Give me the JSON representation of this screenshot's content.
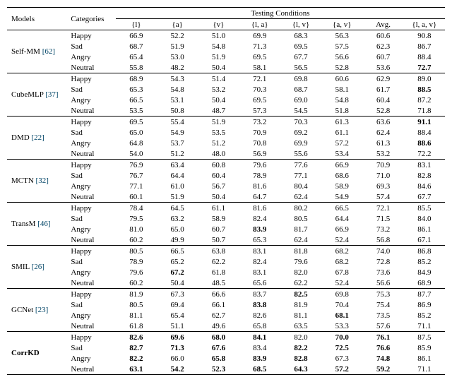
{
  "header": {
    "models": "Models",
    "categories": "Categories",
    "testing": "Testing Conditions",
    "cols": [
      "{l}",
      "{a}",
      "{v}",
      "{l, a}",
      "{l, v}",
      "{a, v}",
      "Avg.",
      "{l, a, v}"
    ]
  },
  "rows": [
    {
      "model": "Self-MM",
      "ref": "[62]",
      "cats": [
        {
          "name": "Happy",
          "vals": [
            "66.9",
            "52.2",
            "51.0",
            "69.9",
            "68.3",
            "56.3",
            "60.6",
            "90.8"
          ],
          "bold": []
        },
        {
          "name": "Sad",
          "vals": [
            "68.7",
            "51.9",
            "54.8",
            "71.3",
            "69.5",
            "57.5",
            "62.3",
            "86.7"
          ],
          "bold": []
        },
        {
          "name": "Angry",
          "vals": [
            "65.4",
            "53.0",
            "51.9",
            "69.5",
            "67.7",
            "56.6",
            "60.7",
            "88.4"
          ],
          "bold": []
        },
        {
          "name": "Neutral",
          "vals": [
            "55.8",
            "48.2",
            "50.4",
            "58.1",
            "56.5",
            "52.8",
            "53.6",
            "72.7"
          ],
          "bold": [
            7
          ]
        }
      ]
    },
    {
      "model": "CubeMLP",
      "ref": "[37]",
      "cats": [
        {
          "name": "Happy",
          "vals": [
            "68.9",
            "54.3",
            "51.4",
            "72.1",
            "69.8",
            "60.6",
            "62.9",
            "89.0"
          ],
          "bold": []
        },
        {
          "name": "Sad",
          "vals": [
            "65.3",
            "54.8",
            "53.2",
            "70.3",
            "68.7",
            "58.1",
            "61.7",
            "88.5"
          ],
          "bold": [
            7
          ]
        },
        {
          "name": "Angry",
          "vals": [
            "66.5",
            "53.1",
            "50.4",
            "69.5",
            "69.0",
            "54.8",
            "60.4",
            "87.2"
          ],
          "bold": []
        },
        {
          "name": "Neutral",
          "vals": [
            "53.5",
            "50.8",
            "48.7",
            "57.3",
            "54.5",
            "51.8",
            "52.8",
            "71.8"
          ],
          "bold": []
        }
      ]
    },
    {
      "model": "DMD",
      "ref": "[22]",
      "cats": [
        {
          "name": "Happy",
          "vals": [
            "69.5",
            "55.4",
            "51.9",
            "73.2",
            "70.3",
            "61.3",
            "63.6",
            "91.1"
          ],
          "bold": [
            7
          ]
        },
        {
          "name": "Sad",
          "vals": [
            "65.0",
            "54.9",
            "53.5",
            "70.9",
            "69.2",
            "61.1",
            "62.4",
            "88.4"
          ],
          "bold": []
        },
        {
          "name": "Angry",
          "vals": [
            "64.8",
            "53.7",
            "51.2",
            "70.8",
            "69.9",
            "57.2",
            "61.3",
            "88.6"
          ],
          "bold": [
            7
          ]
        },
        {
          "name": "Neutral",
          "vals": [
            "54.0",
            "51.2",
            "48.0",
            "56.9",
            "55.6",
            "53.4",
            "53.2",
            "72.2"
          ],
          "bold": []
        }
      ]
    },
    {
      "model": "MCTN",
      "ref": "[32]",
      "cats": [
        {
          "name": "Happy",
          "vals": [
            "76.9",
            "63.4",
            "60.8",
            "79.6",
            "77.6",
            "66.9",
            "70.9",
            "83.1"
          ],
          "bold": []
        },
        {
          "name": "Sad",
          "vals": [
            "76.7",
            "64.4",
            "60.4",
            "78.9",
            "77.1",
            "68.6",
            "71.0",
            "82.8"
          ],
          "bold": []
        },
        {
          "name": "Angry",
          "vals": [
            "77.1",
            "61.0",
            "56.7",
            "81.6",
            "80.4",
            "58.9",
            "69.3",
            "84.6"
          ],
          "bold": []
        },
        {
          "name": "Neutral",
          "vals": [
            "60.1",
            "51.9",
            "50.4",
            "64.7",
            "62.4",
            "54.9",
            "57.4",
            "67.7"
          ],
          "bold": []
        }
      ]
    },
    {
      "model": "TransM",
      "ref": "[46]",
      "cats": [
        {
          "name": "Happy",
          "vals": [
            "78.4",
            "64.5",
            "61.1",
            "81.6",
            "80.2",
            "66.5",
            "72.1",
            "85.5"
          ],
          "bold": []
        },
        {
          "name": "Sad",
          "vals": [
            "79.5",
            "63.2",
            "58.9",
            "82.4",
            "80.5",
            "64.4",
            "71.5",
            "84.0"
          ],
          "bold": []
        },
        {
          "name": "Angry",
          "vals": [
            "81.0",
            "65.0",
            "60.7",
            "83.9",
            "81.7",
            "66.9",
            "73.2",
            "86.1"
          ],
          "bold": [
            3
          ]
        },
        {
          "name": "Neutral",
          "vals": [
            "60.2",
            "49.9",
            "50.7",
            "65.3",
            "62.4",
            "52.4",
            "56.8",
            "67.1"
          ],
          "bold": []
        }
      ]
    },
    {
      "model": "SMIL",
      "ref": "[26]",
      "cats": [
        {
          "name": "Happy",
          "vals": [
            "80.5",
            "66.5",
            "63.8",
            "83.1",
            "81.8",
            "68.2",
            "74.0",
            "86.8"
          ],
          "bold": []
        },
        {
          "name": "Sad",
          "vals": [
            "78.9",
            "65.2",
            "62.2",
            "82.4",
            "79.6",
            "68.2",
            "72.8",
            "85.2"
          ],
          "bold": []
        },
        {
          "name": "Angry",
          "vals": [
            "79.6",
            "67.2",
            "61.8",
            "83.1",
            "82.0",
            "67.8",
            "73.6",
            "84.9"
          ],
          "bold": [
            1
          ]
        },
        {
          "name": "Neutral",
          "vals": [
            "60.2",
            "50.4",
            "48.5",
            "65.6",
            "62.2",
            "52.4",
            "56.6",
            "68.9"
          ],
          "bold": []
        }
      ]
    },
    {
      "model": "GCNet",
      "ref": "[23]",
      "cats": [
        {
          "name": "Happy",
          "vals": [
            "81.9",
            "67.3",
            "66.6",
            "83.7",
            "82.5",
            "69.8",
            "75.3",
            "87.7"
          ],
          "bold": [
            4
          ]
        },
        {
          "name": "Sad",
          "vals": [
            "80.5",
            "69.4",
            "66.1",
            "83.8",
            "81.9",
            "70.4",
            "75.4",
            "86.9"
          ],
          "bold": [
            3
          ]
        },
        {
          "name": "Angry",
          "vals": [
            "81.1",
            "65.4",
            "62.7",
            "82.6",
            "81.1",
            "68.1",
            "73.5",
            "85.2"
          ],
          "bold": [
            5
          ]
        },
        {
          "name": "Neutral",
          "vals": [
            "61.8",
            "51.1",
            "49.6",
            "65.8",
            "63.5",
            "53.3",
            "57.6",
            "71.1"
          ],
          "bold": []
        }
      ]
    },
    {
      "model": "CorrKD",
      "ref": "",
      "bold_model": true,
      "cats": [
        {
          "name": "Happy",
          "vals": [
            "82.6",
            "69.6",
            "68.0",
            "84.1",
            "82.0",
            "70.0",
            "76.1",
            "87.5"
          ],
          "bold": [
            0,
            1,
            2,
            3,
            5,
            6
          ]
        },
        {
          "name": "Sad",
          "vals": [
            "82.7",
            "71.3",
            "67.6",
            "83.4",
            "82.2",
            "72.5",
            "76.6",
            "85.9"
          ],
          "bold": [
            0,
            1,
            2,
            4,
            5,
            6
          ]
        },
        {
          "name": "Angry",
          "vals": [
            "82.2",
            "66.0",
            "65.8",
            "83.9",
            "82.8",
            "67.3",
            "74.8",
            "86.1"
          ],
          "bold": [
            0,
            2,
            3,
            4,
            6
          ]
        },
        {
          "name": "Neutral",
          "vals": [
            "63.1",
            "54.2",
            "52.3",
            "68.5",
            "64.3",
            "57.2",
            "59.2",
            "71.1"
          ],
          "bold": [
            0,
            1,
            2,
            3,
            4,
            5,
            6
          ]
        }
      ]
    }
  ]
}
